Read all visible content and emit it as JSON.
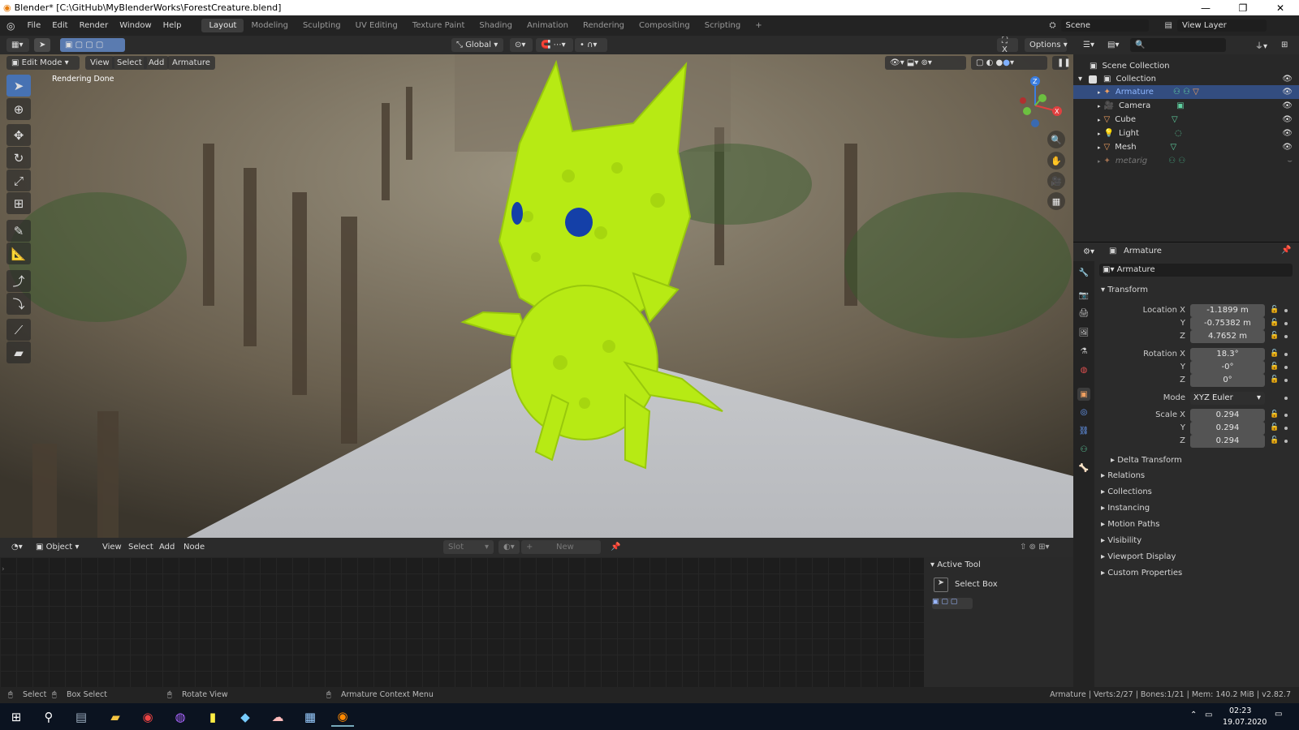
{
  "window": {
    "title": "Blender* [C:\\GitHub\\MyBlenderWorks\\ForestCreature.blend]"
  },
  "menu": {
    "items": [
      "File",
      "Edit",
      "Render",
      "Window",
      "Help"
    ]
  },
  "workspaces": [
    "Layout",
    "Modeling",
    "Sculpting",
    "UV Editing",
    "Texture Paint",
    "Shading",
    "Animation",
    "Rendering",
    "Compositing",
    "Scripting"
  ],
  "scene": {
    "name": "Scene",
    "view_layer": "View Layer"
  },
  "header": {
    "orientation": "Global",
    "options": "Options"
  },
  "viewport": {
    "mode": "Edit Mode",
    "menu": [
      "View",
      "Select",
      "Add",
      "Armature"
    ],
    "status": "Rendering Done"
  },
  "outliner": {
    "root": "Scene Collection",
    "collection": "Collection",
    "items": [
      {
        "name": "Armature",
        "selected": true
      },
      {
        "name": "Camera",
        "selected": false
      },
      {
        "name": "Cube",
        "selected": false
      },
      {
        "name": "Light",
        "selected": false
      },
      {
        "name": "Mesh",
        "selected": false
      },
      {
        "name": "metarig",
        "selected": false,
        "dim": true
      }
    ]
  },
  "properties": {
    "object_name": "Armature",
    "data_name": "Armature",
    "transform_title": "Transform",
    "location_x_label": "Location X",
    "y_label": "Y",
    "z_label": "Z",
    "location": [
      "-1.1899 m",
      "-0.75382 m",
      "4.7652 m"
    ],
    "rotation_x_label": "Rotation X",
    "rotation": [
      "18.3°",
      "-0°",
      "0°"
    ],
    "mode_label": "Mode",
    "mode": "XYZ Euler",
    "scale_x_label": "Scale X",
    "scale": [
      "0.294",
      "0.294",
      "0.294"
    ],
    "delta": "Delta Transform",
    "sections": [
      "Relations",
      "Collections",
      "Instancing",
      "Motion Paths",
      "Visibility",
      "Viewport Display",
      "Custom Properties"
    ]
  },
  "node_editor": {
    "type": "Object",
    "menu": [
      "View",
      "Select",
      "Add",
      "Node"
    ],
    "slot": "Slot",
    "new": "New"
  },
  "active_tool": {
    "title": "Active Tool",
    "tool": "Select Box"
  },
  "statusbar": {
    "select": "Select",
    "box_select": "Box Select",
    "rotate": "Rotate View",
    "context": "Armature Context Menu",
    "info": "Armature | Verts:2/27 | Bones:1/21 | Mem: 140.2 MiB | v2.82.7"
  },
  "taskbar": {
    "time": "02:23",
    "date": "19.07.2020"
  }
}
